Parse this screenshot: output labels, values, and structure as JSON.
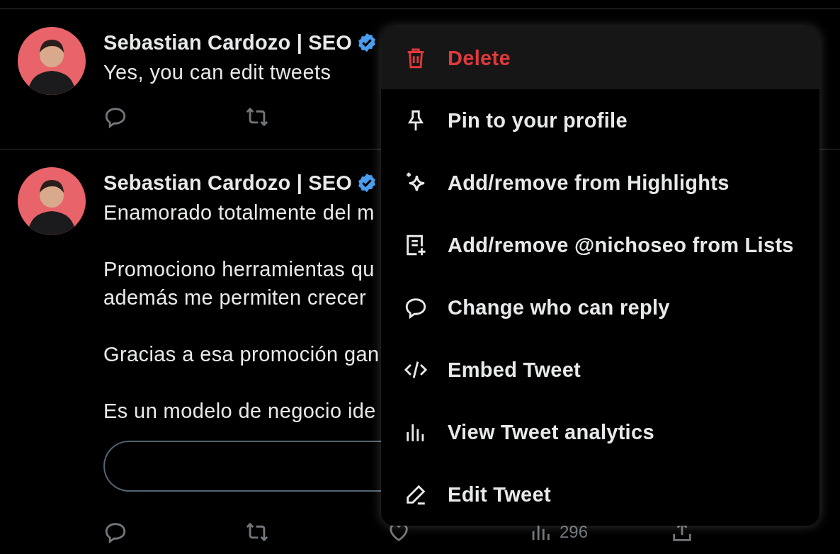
{
  "tweets": [
    {
      "author": "Sebastian Cardozo | SEO",
      "verified": true,
      "paragraphs": [
        [
          "Yes, you can edit tweets"
        ]
      ],
      "reply_field": false,
      "actions": [
        {
          "kind": "reply"
        },
        {
          "kind": "retweet"
        }
      ]
    },
    {
      "author": "Sebastian Cardozo | SEO",
      "verified": true,
      "paragraphs": [
        [
          "Enamorado totalmente del m"
        ],
        [
          "Promociono herramientas qu",
          "además me permiten crecer"
        ],
        [
          "Gracias a esa promoción gan"
        ],
        [
          "Es un modelo de negocio ide"
        ]
      ],
      "reply_field": true,
      "actions": [
        {
          "kind": "reply"
        },
        {
          "kind": "retweet"
        },
        {
          "kind": "like"
        },
        {
          "kind": "views",
          "count": "296"
        },
        {
          "kind": "share"
        }
      ]
    }
  ],
  "menu": {
    "items": [
      {
        "kind": "delete",
        "label": "Delete",
        "danger": true,
        "selected": true
      },
      {
        "kind": "pin",
        "label": "Pin to your profile",
        "danger": false,
        "selected": false
      },
      {
        "kind": "highlight",
        "label": "Add/remove from Highlights",
        "danger": false,
        "selected": false
      },
      {
        "kind": "list",
        "label": "Add/remove @nichoseo from Lists",
        "danger": false,
        "selected": false
      },
      {
        "kind": "reply",
        "label": "Change who can reply",
        "danger": false,
        "selected": false
      },
      {
        "kind": "embed",
        "label": "Embed Tweet",
        "danger": false,
        "selected": false
      },
      {
        "kind": "analytics",
        "label": "View Tweet analytics",
        "danger": false,
        "selected": false
      },
      {
        "kind": "edit",
        "label": "Edit Tweet",
        "danger": false,
        "selected": false
      }
    ]
  }
}
